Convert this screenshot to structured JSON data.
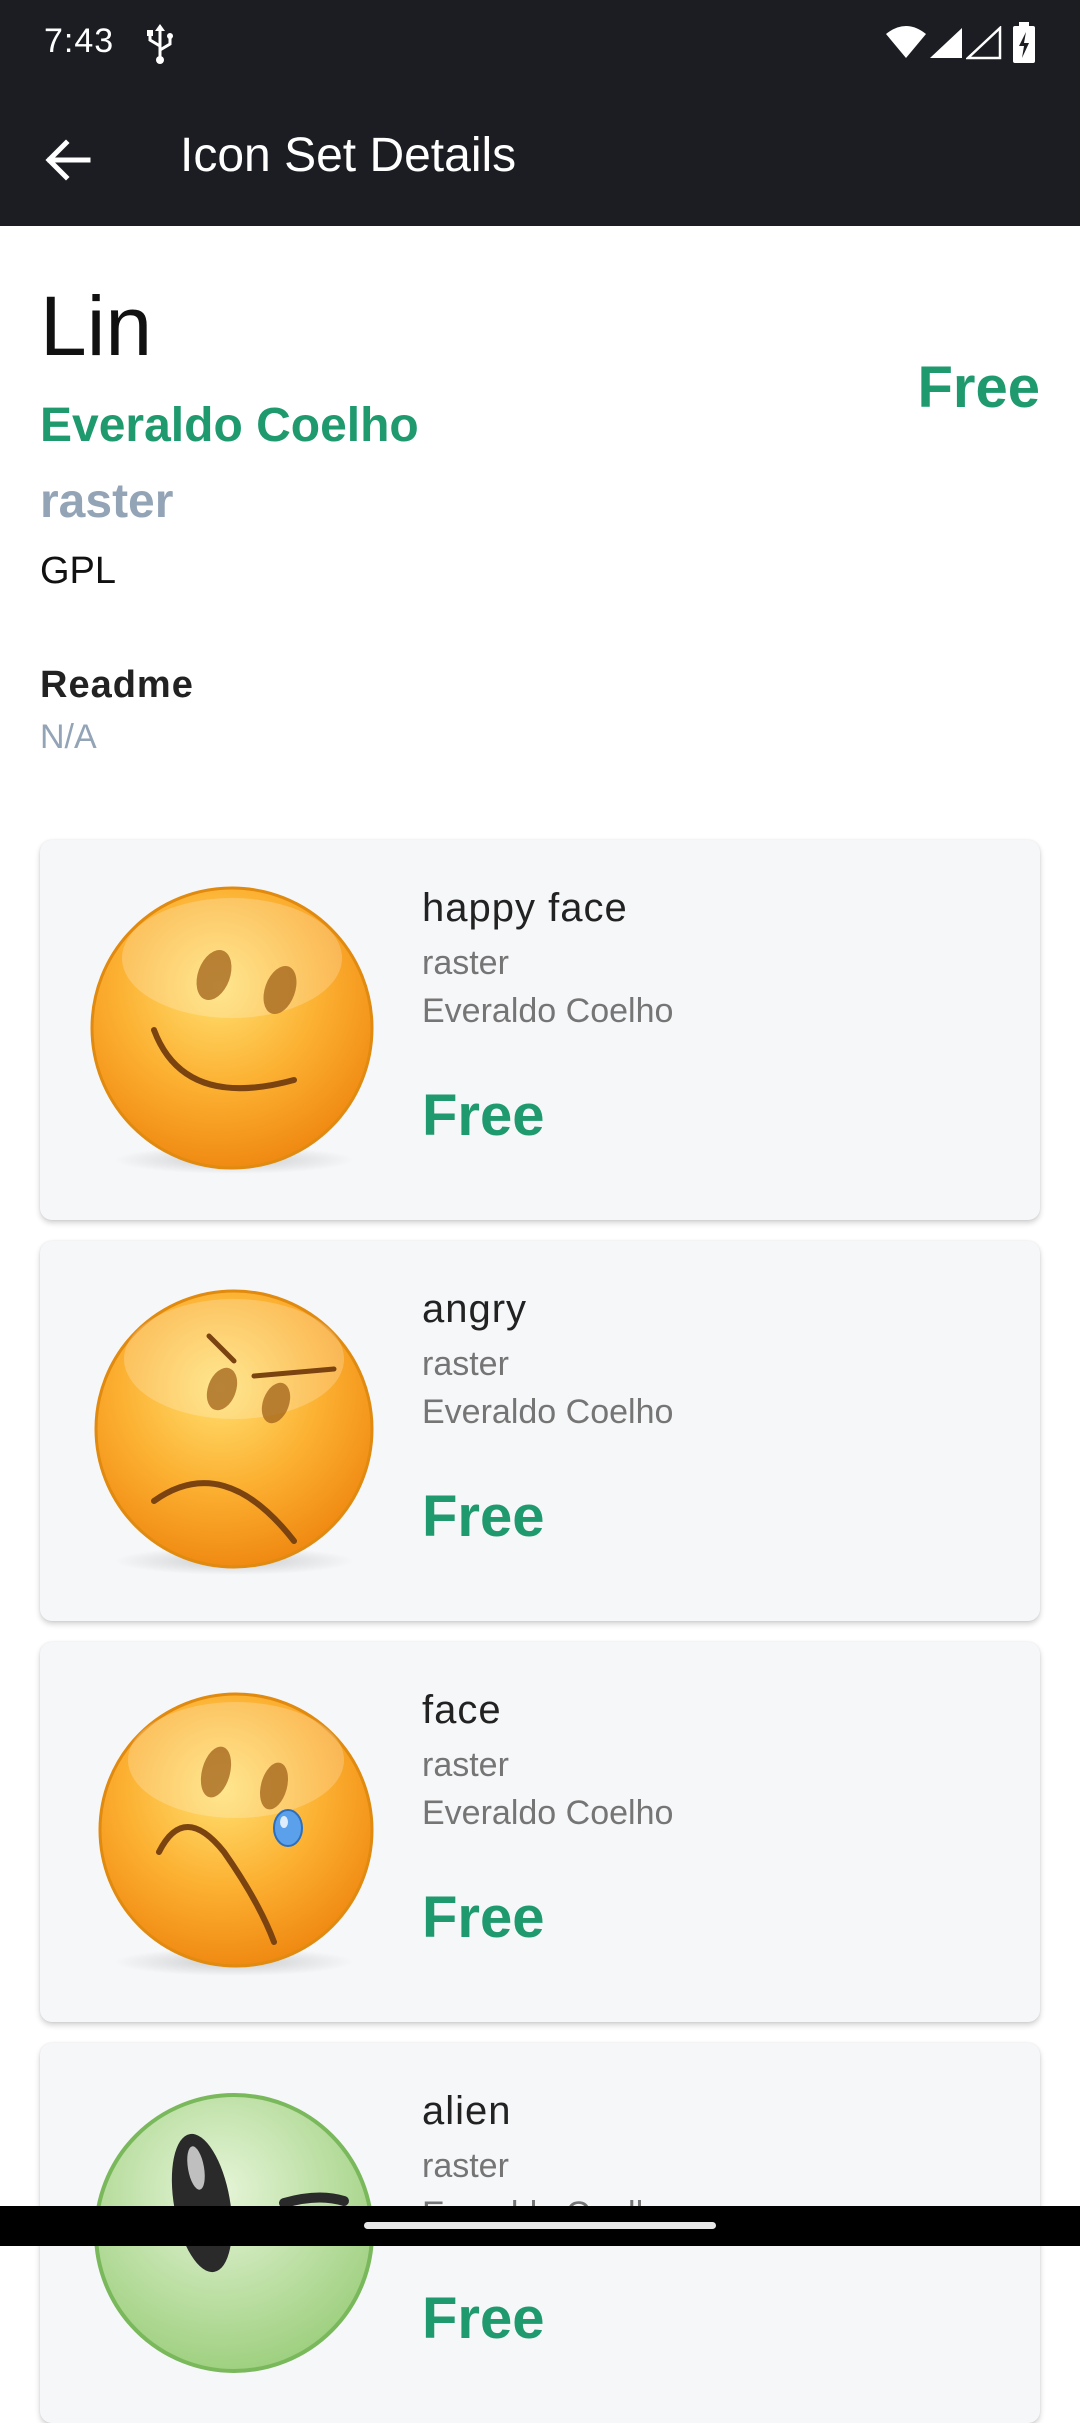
{
  "status_bar": {
    "time": "7:43",
    "icons": [
      "usb-icon",
      "wifi-icon",
      "signal-icon",
      "signal-icon",
      "battery-icon"
    ]
  },
  "app_bar": {
    "title": "Icon Set Details",
    "back_icon": "arrow-back-icon"
  },
  "icon_set": {
    "name": "Lin",
    "author": "Everaldo Coelho",
    "type": "raster",
    "license": "GPL",
    "price": "Free",
    "readme_heading": "Readme",
    "readme_value": "N/A"
  },
  "icons": [
    {
      "name": "happy face",
      "type": "raster",
      "author": "Everaldo Coelho",
      "price": "Free",
      "icon": "happy-face-icon"
    },
    {
      "name": "angry",
      "type": "raster",
      "author": "Everaldo Coelho",
      "price": "Free",
      "icon": "angry-face-icon"
    },
    {
      "name": "face",
      "type": "raster",
      "author": "Everaldo Coelho",
      "price": "Free",
      "icon": "crying-face-icon"
    },
    {
      "name": "alien",
      "type": "raster",
      "author": "Everaldo Coelho",
      "price": "Free",
      "icon": "alien-icon"
    }
  ],
  "colors": {
    "bar_background": "#1b1d22",
    "accent_green": "#1e9a6e",
    "muted_blue_gray": "#93a4b7",
    "card_background": "#f6f7f9"
  }
}
